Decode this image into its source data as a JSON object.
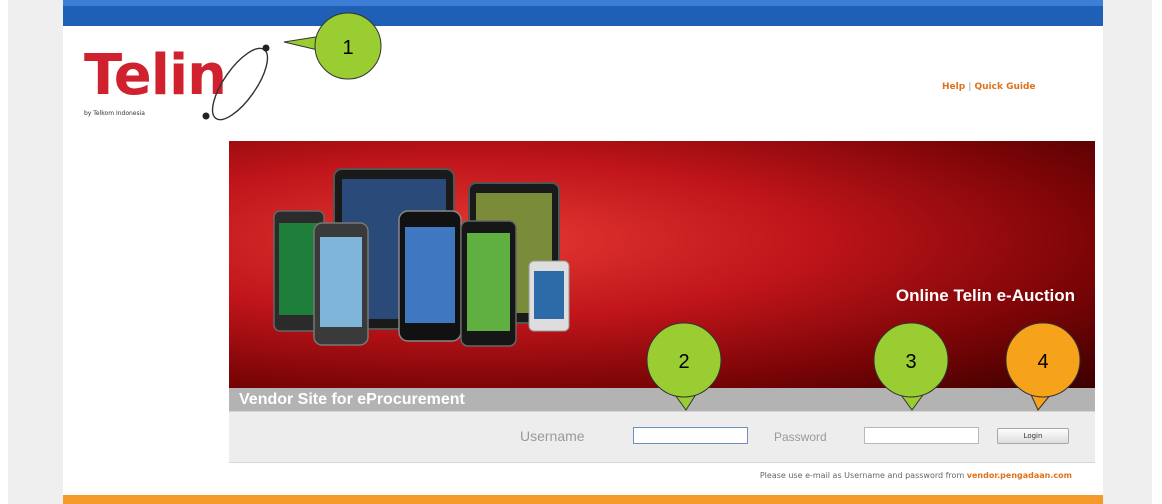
{
  "header": {
    "logo_text": "Telin",
    "logo_tagline": "by Telkom Indonesia",
    "help_label": "Help",
    "separator": "|",
    "quick_guide_label": "Quick Guide"
  },
  "banner": {
    "title": "Online Telin e-Auction",
    "subtitle": "Vendor Site for eProcurement"
  },
  "login": {
    "username_label": "Username",
    "username_value": "",
    "password_label": "Password",
    "password_value": "",
    "login_button_label": "Login"
  },
  "note": {
    "text": "Please use e-mail as Username and password from",
    "link": "vendor.pengadaan.com"
  },
  "callouts": [
    {
      "number": "1",
      "color": "#9acd32"
    },
    {
      "number": "2",
      "color": "#9acd32"
    },
    {
      "number": "3",
      "color": "#9acd32"
    },
    {
      "number": "4",
      "color": "#f7a21b"
    }
  ],
  "colors": {
    "brand_red": "#d0222e",
    "top_bar_blue": "#1f5fb5",
    "link_orange": "#e0711b",
    "footer_orange": "#f39a2a"
  }
}
